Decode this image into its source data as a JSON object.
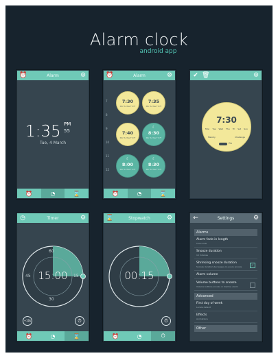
{
  "header": {
    "title": "Alarm clock",
    "subtitle": "android app"
  },
  "colors": {
    "background": "#17232d",
    "accent": "#6fc9b7",
    "screen": "#36454f",
    "bubble_yellow": "#f3e89a",
    "bubble_teal": "#5ab5a3"
  },
  "screen_alarm": {
    "title": "Alarm",
    "time": "1:35",
    "ampm": "PM",
    "seconds": "55",
    "date": "Tue, 4 March",
    "icons": {
      "left": "alarm-clock-icon",
      "right": "gear-icon"
    },
    "tabs": [
      "alarm-icon",
      "clock-icon",
      "hourglass-icon"
    ]
  },
  "screen_alarm_list": {
    "title": "Alarm",
    "ruler": [
      "7",
      "8",
      "9",
      "10",
      "11",
      "12"
    ],
    "alarms": [
      {
        "time": "7:30",
        "ampm": "AM",
        "style": "yellow",
        "days": "Mo Tu We Th Fr"
      },
      {
        "time": "7:35",
        "ampm": "AM",
        "style": "yellow",
        "days": "Mo Tu We Th Fr"
      },
      {
        "time": "7:40",
        "ampm": "AM",
        "style": "yellow",
        "days": "Mo Tu We Th Fr"
      },
      {
        "time": "8:30",
        "ampm": "AM",
        "style": "teal",
        "days": "Mo Tu We Th Fr"
      },
      {
        "time": "8:00",
        "ampm": "PM",
        "style": "teal",
        "days": "Mo Tu We Th Fr"
      },
      {
        "time": "8:30",
        "ampm": "PM",
        "style": "teal",
        "days": "Mo Tu We Th Fr"
      }
    ]
  },
  "screen_alarm_edit": {
    "time": "7:30",
    "ampm": "AM",
    "days": [
      "Mon",
      "Tue",
      "Wed",
      "Thu",
      "Fri",
      "Sat",
      "Sun"
    ],
    "options": [
      "Melody",
      "Challenge"
    ],
    "toggle": "On"
  },
  "screen_timer": {
    "title": "Timer",
    "time": "15:00",
    "marks": {
      "top": "60",
      "left": "45",
      "right": "15",
      "bottom": "30"
    },
    "add_button": "+10s",
    "progress": 0.25
  },
  "screen_stopwatch": {
    "title": "Stopwatch",
    "time": "00:15",
    "progress": 0.25
  },
  "screen_settings": {
    "title": "Settings",
    "sections": [
      {
        "name": "Alarms",
        "items": [
          {
            "label": "Alarm fade-in length",
            "sub": "5 seconds",
            "check": null
          },
          {
            "label": "Snooze duration",
            "sub": "10 minutes",
            "check": null
          },
          {
            "label": "Shrinking snooze duration",
            "sub": "Snooze duration decreases on every snooze",
            "check": true
          },
          {
            "label": "Alarm volume",
            "sub": "",
            "check": null
          },
          {
            "label": "Volume buttons to snooze",
            "sub": "Volume buttons snooze or dismiss alarm",
            "check": false
          }
        ]
      },
      {
        "name": "Advanced",
        "items": [
          {
            "label": "First day of week",
            "sub": "Locale default",
            "check": null
          },
          {
            "label": "Effects",
            "sub": "Animations",
            "check": null
          }
        ]
      },
      {
        "name": "Other",
        "items": []
      }
    ]
  }
}
